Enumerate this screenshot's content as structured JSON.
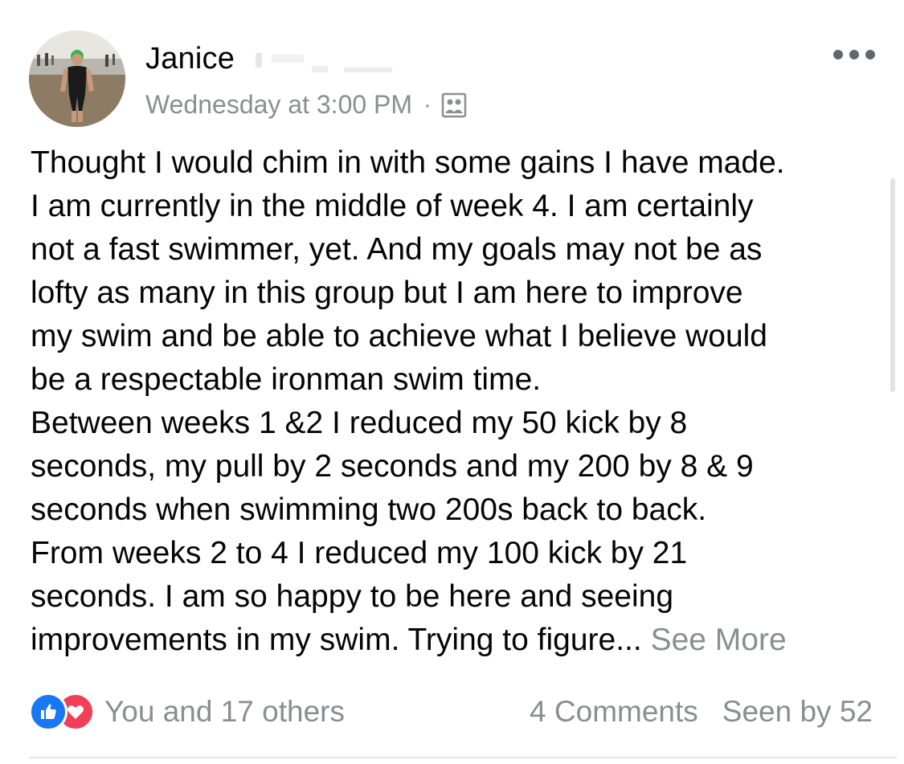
{
  "post": {
    "author_name": "Janice",
    "timestamp": "Wednesday at 3:00 PM",
    "separator": "·",
    "audience_icon": "group-audience-icon",
    "more_icon": "more-options-icon",
    "body_lines": [
      "Thought I would chim in with some gains I have made.",
      "I am currently in the middle of week 4. I am certainly",
      "not a fast swimmer, yet. And my goals may not be as",
      "lofty as many in this group but I am here to improve",
      "my swim and be able to achieve what I believe would",
      "be a respectable ironman swim time.",
      "Between weeks 1 &2 I reduced my 50 kick by 8",
      "seconds, my pull by 2 seconds and my 200 by 8 & 9",
      "seconds when swimming two 200s back to back.",
      "From weeks 2 to 4 I reduced my 100 kick by 21",
      "seconds. I am so happy to be here and seeing",
      "improvements in my swim. Trying to figure..."
    ],
    "see_more_label": "See More"
  },
  "footer": {
    "reaction_icons": [
      "like-reaction-icon",
      "love-reaction-icon"
    ],
    "reactions_text": "You and 17 others",
    "comments_text": "4 Comments",
    "seen_text": "Seen by 52"
  },
  "colors": {
    "like_blue": "#1877f2",
    "love_red": "#f33e58",
    "meta_gray": "#8a8d91",
    "text_dark": "#050505"
  }
}
